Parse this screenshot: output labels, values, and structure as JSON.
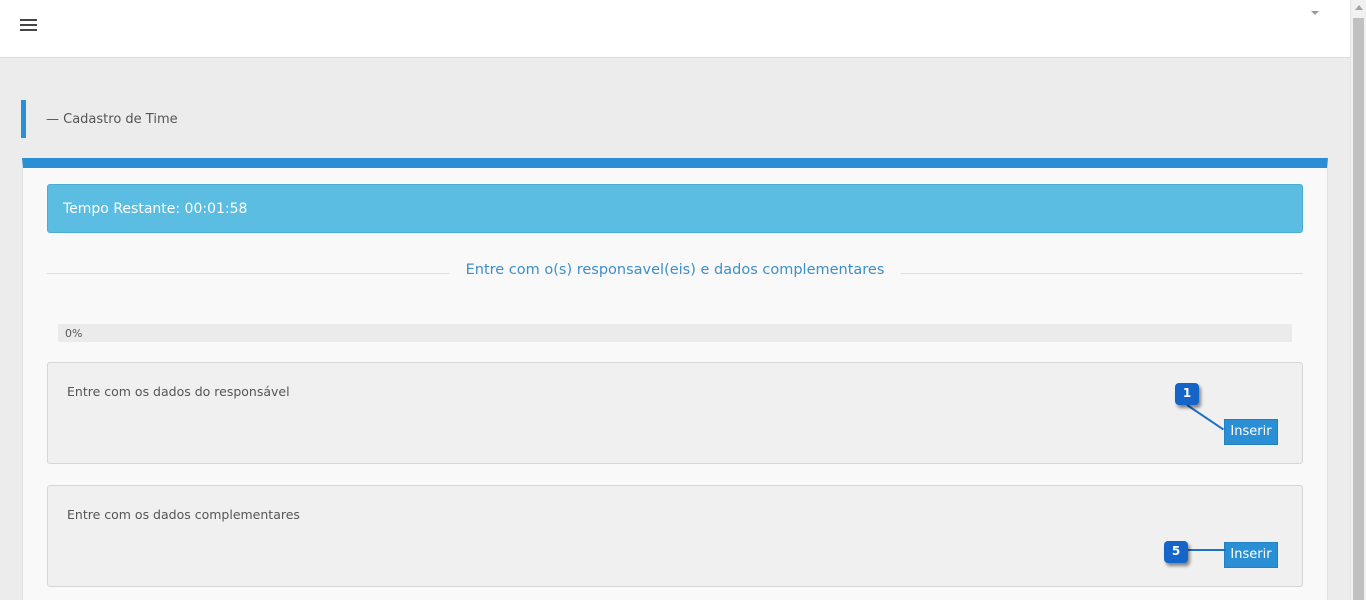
{
  "header": {
    "menu_icon": "hamburger-icon",
    "dropdown_icon": "caret-down-icon"
  },
  "page": {
    "title": "— Cadastro de Time"
  },
  "timer": {
    "text": "Tempo Restante: 00:01:58"
  },
  "section": {
    "heading": "Entre com o(s) responsavel(eis) e dados complementares"
  },
  "progress": {
    "label": "0%",
    "value": 0
  },
  "panels": [
    {
      "text": "Entre com os dados do responsável",
      "button_label": "Inserir",
      "callout": "1"
    },
    {
      "text": "Entre com os dados complementares",
      "button_label": "Inserir",
      "callout": "5"
    }
  ],
  "colors": {
    "accent": "#2b8fd6",
    "alert_bg": "#5bbde1",
    "callout": "#1565c8"
  }
}
